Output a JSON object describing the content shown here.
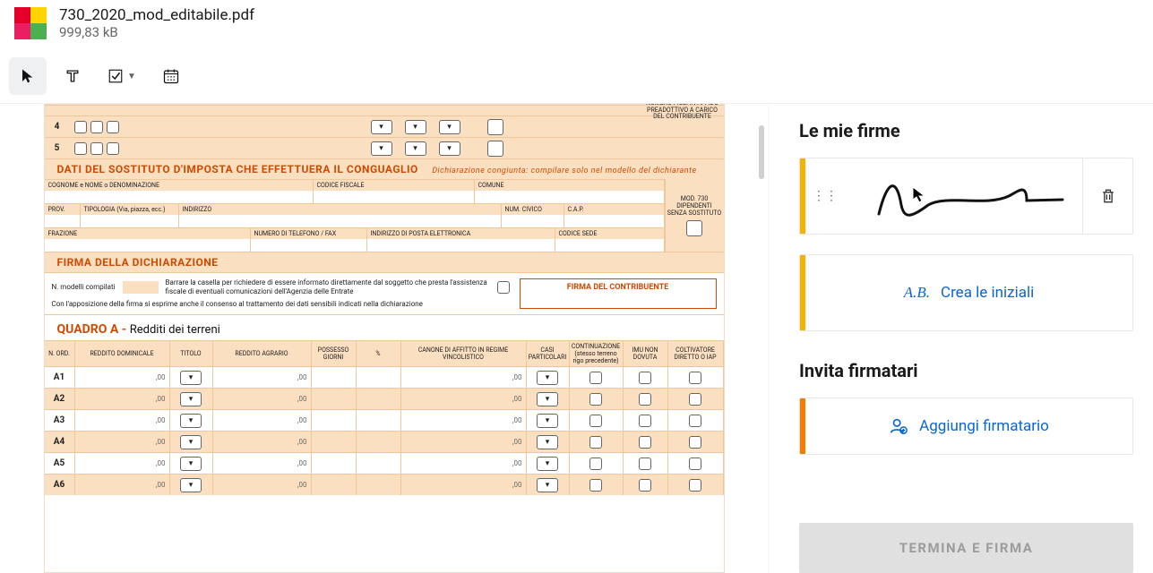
{
  "header": {
    "file_name": "730_2020_mod_editabile.pdf",
    "file_size": "999,83 kB"
  },
  "toolbar": {
    "cursor_tool": "pointer",
    "text_tool": "T",
    "check_tool": "checkbox",
    "date_tool": "calendar"
  },
  "doc": {
    "right_note": "NUMERO FIGLI IN AFFIDO PREADOTTIVO A CARICO DEL CONTRIBUENTE",
    "row4": "4",
    "row5": "5",
    "section_sostituto": "DATI DEL SOSTITUTO D'IMPOSTA CHE EFFETTUERA IL CONGUAGLIO",
    "section_sostituto_sub": "Dichiarazione congiunta: compilare solo nel modello del dichiarante",
    "labels_row1": [
      "COGNOME e NOME o DENOMINAZIONE",
      "CODICE FISCALE",
      "COMUNE"
    ],
    "mod_box": "MOD. 730 DIPENDENTI SENZA SOSTITUTO",
    "labels_row2": [
      "PROV.",
      "TIPOLOGIA (Via, piazza, ecc.)",
      "INDIRIZZO",
      "NUM. CIVICO",
      "C.A.P."
    ],
    "labels_row3": [
      "FRAZIONE",
      "NUMERO DI TELEFONO / FAX",
      "INDIRIZZO DI POSTA ELETTRONICA",
      "CODICE SEDE"
    ],
    "section_firma": "FIRMA DELLA DICHIARAZIONE",
    "firma_text1": "N. modelli compilati",
    "firma_text2": "Barrare la casella per richiedere di essere informato direttamente dal soggetto che presta l'assistenza fiscale di eventuali comunicazioni dell'Agenzia delle Entrate",
    "firma_text3": "Con l'apposizione della firma si esprime anche il consenso al trattamento dei dati sensibili indicati nella dichiarazione",
    "firma_field": "FIRMA DEL CONTRIBUENTE",
    "quadro_a": "QUADRO A -",
    "quadro_a_sub": "Redditi dei terreni",
    "table_headers": [
      "N. ORD.",
      "REDDITO DOMINICALE",
      "TITOLO",
      "REDDITO AGRARIO",
      "POSSESSO GIORNI",
      "%",
      "CANONE DI AFFITTO IN REGIME VINCOLISTICO",
      "CASI PARTICOLARI",
      "CONTINUAZIONE (stesso terreno rigo precedente)",
      "IMU NON DOVUTA",
      "COLTIVATORE DIRETTO O IAP"
    ],
    "comma": ",00",
    "rows": [
      "A1",
      "A2",
      "A3",
      "A4",
      "A5",
      "A6"
    ]
  },
  "sidebar": {
    "my_sigs": "Le mie firme",
    "initials_ic": "A.B.",
    "create_initials": "Crea le iniziali",
    "invite_title": "Invita firmatari",
    "add_signer": "Aggiungi firmatario",
    "finish": "TERMINA E FIRMA"
  }
}
